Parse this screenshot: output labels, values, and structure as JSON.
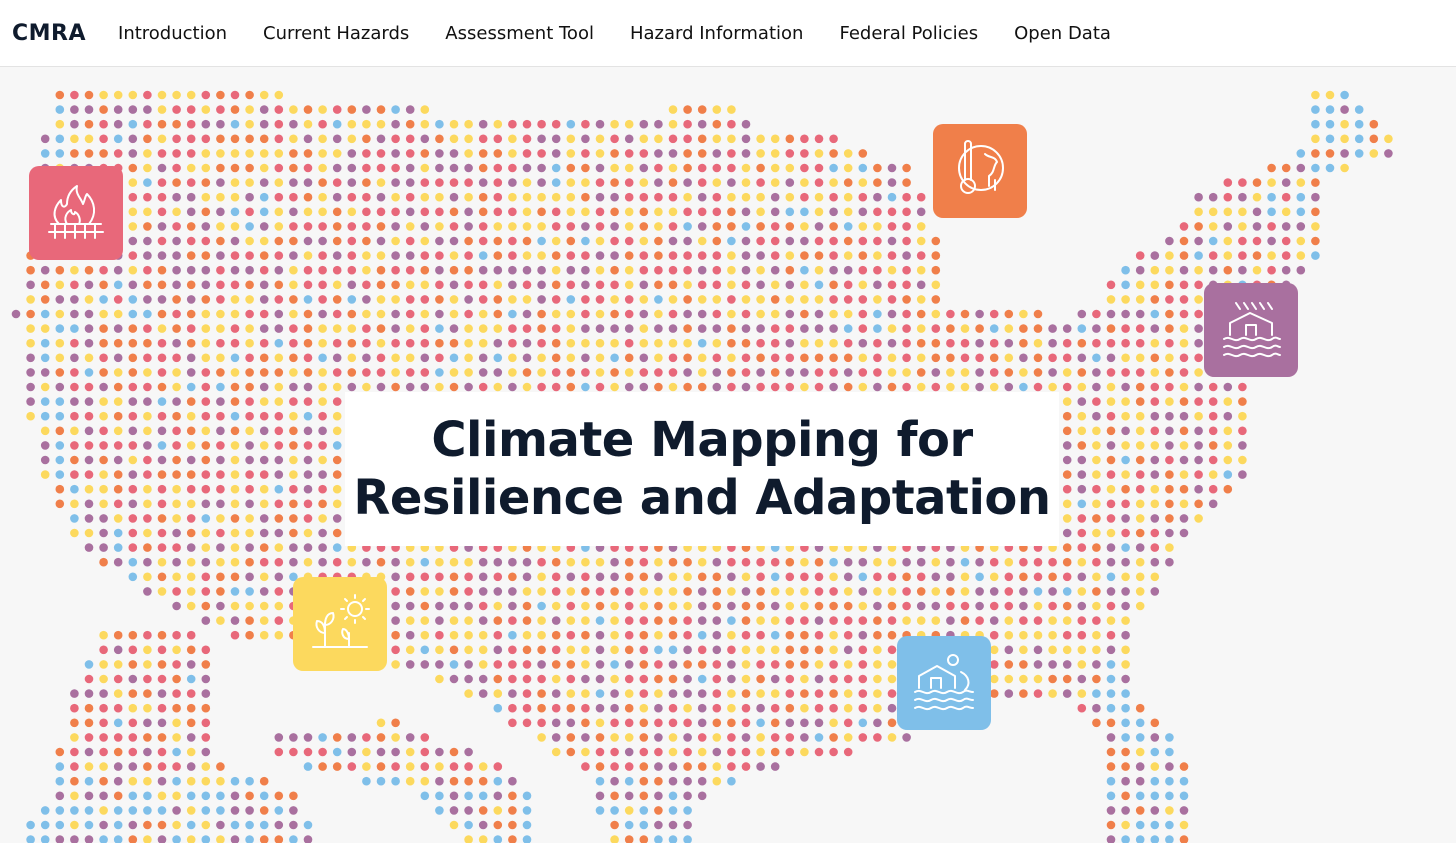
{
  "header": {
    "logo": "CMRA",
    "nav": [
      {
        "label": "Introduction"
      },
      {
        "label": "Current Hazards"
      },
      {
        "label": "Assessment Tool"
      },
      {
        "label": "Hazard Information"
      },
      {
        "label": "Federal Policies"
      },
      {
        "label": "Open Data"
      }
    ]
  },
  "hero": {
    "title_line1": "Climate Mapping for",
    "title_line2": "Resilience and Adaptation"
  },
  "hazards": [
    {
      "icon": "wildfire-icon",
      "color": "#e8687a"
    },
    {
      "icon": "extreme-heat-icon",
      "color": "#f07f4a"
    },
    {
      "icon": "drought-icon",
      "color": "#fcd95e"
    },
    {
      "icon": "coastal-inundation-icon",
      "color": "#7fbfe9"
    },
    {
      "icon": "inland-flooding-icon",
      "color": "#a9709f"
    }
  ],
  "map_colors": [
    "#e8687a",
    "#fcd95e",
    "#a9709f",
    "#f07f4a",
    "#7fbfe9"
  ]
}
